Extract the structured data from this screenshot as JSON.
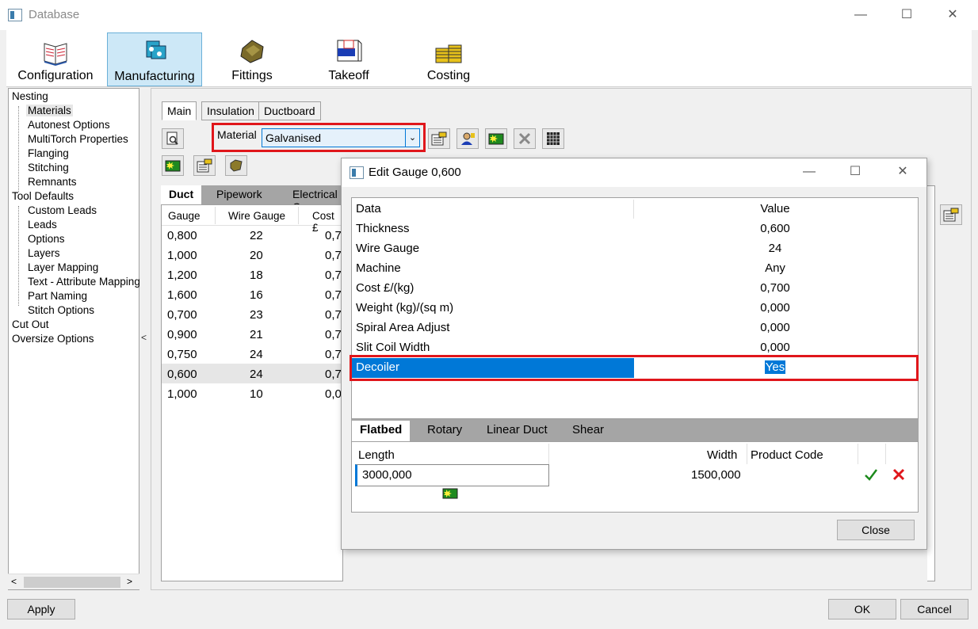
{
  "window": {
    "title": "Database"
  },
  "ribbon": {
    "tabs": [
      {
        "label": "Configuration",
        "icon": "book-icon"
      },
      {
        "label": "Manufacturing",
        "icon": "machine-icon"
      },
      {
        "label": "Fittings",
        "icon": "fitting-icon"
      },
      {
        "label": "Takeoff",
        "icon": "takeoff-icon"
      },
      {
        "label": "Costing",
        "icon": "coins-icon"
      }
    ]
  },
  "tree": {
    "items": [
      {
        "label": "Nesting",
        "level": 0
      },
      {
        "label": "Materials",
        "level": 1,
        "selected": true
      },
      {
        "label": "Autonest Options",
        "level": 1
      },
      {
        "label": "MultiTorch Properties",
        "level": 1
      },
      {
        "label": "Flanging",
        "level": 1
      },
      {
        "label": "Stitching",
        "level": 1
      },
      {
        "label": "Remnants",
        "level": 1
      },
      {
        "label": "Tool Defaults",
        "level": 0
      },
      {
        "label": "Custom Leads",
        "level": 1
      },
      {
        "label": "Leads",
        "level": 1
      },
      {
        "label": "Options",
        "level": 1
      },
      {
        "label": "Layers",
        "level": 1
      },
      {
        "label": "Layer Mapping",
        "level": 1
      },
      {
        "label": "Text - Attribute Mapping",
        "level": 1
      },
      {
        "label": "Part Naming",
        "level": 1
      },
      {
        "label": "Stitch Options",
        "level": 1
      },
      {
        "label": "Cut Out",
        "level": 0
      },
      {
        "label": "Oversize Options",
        "level": 0
      }
    ]
  },
  "material_tabs": [
    "Main",
    "Insulation",
    "Ductboard"
  ],
  "material": {
    "label": "Material",
    "value": "Galvanised"
  },
  "sub_tabs": [
    "Duct",
    "Pipework",
    "Electrical C"
  ],
  "grid": {
    "headers": [
      "Gauge",
      "Wire Gauge",
      "Cost £"
    ],
    "rows": [
      [
        "0,800",
        "22",
        "0,7"
      ],
      [
        "1,000",
        "20",
        "0,7"
      ],
      [
        "1,200",
        "18",
        "0,7"
      ],
      [
        "1,600",
        "16",
        "0,7"
      ],
      [
        "0,700",
        "23",
        "0,7"
      ],
      [
        "0,900",
        "21",
        "0,7"
      ],
      [
        "0,750",
        "24",
        "0,7"
      ],
      [
        "0,600",
        "24",
        "0,7"
      ],
      [
        "1,000",
        "10",
        "0,0"
      ]
    ],
    "selected_row": 7
  },
  "dialog": {
    "title": "Edit Gauge 0,600",
    "columns": [
      "Data",
      "Value"
    ],
    "rows": [
      [
        "Thickness",
        "0,600"
      ],
      [
        "Wire Gauge",
        "24"
      ],
      [
        "Machine",
        "Any"
      ],
      [
        "Cost £/(kg)",
        "0,700"
      ],
      [
        "Weight (kg)/(sq m)",
        "0,000"
      ],
      [
        "Spiral Area Adjust",
        "0,000"
      ],
      [
        "Slit Coil Width",
        "0,000"
      ],
      [
        "Decoiler",
        "Yes"
      ]
    ],
    "machine_tabs": [
      "Flatbed",
      "Rotary",
      "Linear Duct",
      "Shear"
    ],
    "sheet_headers": [
      "Length",
      "Width",
      "Product Code"
    ],
    "sheet_row": {
      "length": "3000,000",
      "width": "1500,000",
      "product_code": ""
    },
    "close_label": "Close"
  },
  "footer": {
    "apply": "Apply",
    "ok": "OK",
    "cancel": "Cancel"
  },
  "colors": {
    "selection": "#0078d7",
    "highlight": "#e0161b",
    "ribbon_selected": "#cde8f7"
  }
}
